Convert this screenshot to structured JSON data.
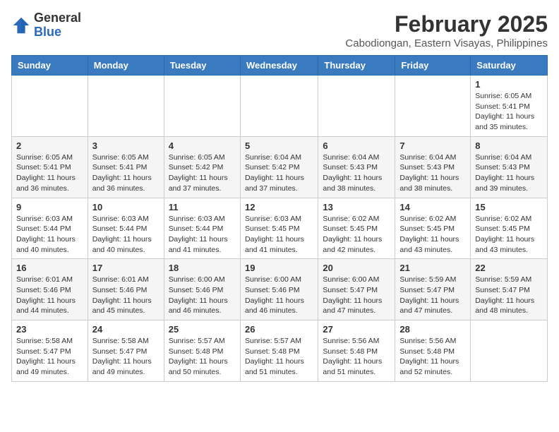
{
  "header": {
    "logo_general": "General",
    "logo_blue": "Blue",
    "month_year": "February 2025",
    "location": "Cabodiongan, Eastern Visayas, Philippines"
  },
  "days_of_week": [
    "Sunday",
    "Monday",
    "Tuesday",
    "Wednesday",
    "Thursday",
    "Friday",
    "Saturday"
  ],
  "weeks": [
    [
      {
        "day": "",
        "info": ""
      },
      {
        "day": "",
        "info": ""
      },
      {
        "day": "",
        "info": ""
      },
      {
        "day": "",
        "info": ""
      },
      {
        "day": "",
        "info": ""
      },
      {
        "day": "",
        "info": ""
      },
      {
        "day": "1",
        "info": "Sunrise: 6:05 AM\nSunset: 5:41 PM\nDaylight: 11 hours and 35 minutes."
      }
    ],
    [
      {
        "day": "2",
        "info": "Sunrise: 6:05 AM\nSunset: 5:41 PM\nDaylight: 11 hours and 36 minutes."
      },
      {
        "day": "3",
        "info": "Sunrise: 6:05 AM\nSunset: 5:41 PM\nDaylight: 11 hours and 36 minutes."
      },
      {
        "day": "4",
        "info": "Sunrise: 6:05 AM\nSunset: 5:42 PM\nDaylight: 11 hours and 37 minutes."
      },
      {
        "day": "5",
        "info": "Sunrise: 6:04 AM\nSunset: 5:42 PM\nDaylight: 11 hours and 37 minutes."
      },
      {
        "day": "6",
        "info": "Sunrise: 6:04 AM\nSunset: 5:43 PM\nDaylight: 11 hours and 38 minutes."
      },
      {
        "day": "7",
        "info": "Sunrise: 6:04 AM\nSunset: 5:43 PM\nDaylight: 11 hours and 38 minutes."
      },
      {
        "day": "8",
        "info": "Sunrise: 6:04 AM\nSunset: 5:43 PM\nDaylight: 11 hours and 39 minutes."
      }
    ],
    [
      {
        "day": "9",
        "info": "Sunrise: 6:03 AM\nSunset: 5:44 PM\nDaylight: 11 hours and 40 minutes."
      },
      {
        "day": "10",
        "info": "Sunrise: 6:03 AM\nSunset: 5:44 PM\nDaylight: 11 hours and 40 minutes."
      },
      {
        "day": "11",
        "info": "Sunrise: 6:03 AM\nSunset: 5:44 PM\nDaylight: 11 hours and 41 minutes."
      },
      {
        "day": "12",
        "info": "Sunrise: 6:03 AM\nSunset: 5:45 PM\nDaylight: 11 hours and 41 minutes."
      },
      {
        "day": "13",
        "info": "Sunrise: 6:02 AM\nSunset: 5:45 PM\nDaylight: 11 hours and 42 minutes."
      },
      {
        "day": "14",
        "info": "Sunrise: 6:02 AM\nSunset: 5:45 PM\nDaylight: 11 hours and 43 minutes."
      },
      {
        "day": "15",
        "info": "Sunrise: 6:02 AM\nSunset: 5:45 PM\nDaylight: 11 hours and 43 minutes."
      }
    ],
    [
      {
        "day": "16",
        "info": "Sunrise: 6:01 AM\nSunset: 5:46 PM\nDaylight: 11 hours and 44 minutes."
      },
      {
        "day": "17",
        "info": "Sunrise: 6:01 AM\nSunset: 5:46 PM\nDaylight: 11 hours and 45 minutes."
      },
      {
        "day": "18",
        "info": "Sunrise: 6:00 AM\nSunset: 5:46 PM\nDaylight: 11 hours and 46 minutes."
      },
      {
        "day": "19",
        "info": "Sunrise: 6:00 AM\nSunset: 5:46 PM\nDaylight: 11 hours and 46 minutes."
      },
      {
        "day": "20",
        "info": "Sunrise: 6:00 AM\nSunset: 5:47 PM\nDaylight: 11 hours and 47 minutes."
      },
      {
        "day": "21",
        "info": "Sunrise: 5:59 AM\nSunset: 5:47 PM\nDaylight: 11 hours and 47 minutes."
      },
      {
        "day": "22",
        "info": "Sunrise: 5:59 AM\nSunset: 5:47 PM\nDaylight: 11 hours and 48 minutes."
      }
    ],
    [
      {
        "day": "23",
        "info": "Sunrise: 5:58 AM\nSunset: 5:47 PM\nDaylight: 11 hours and 49 minutes."
      },
      {
        "day": "24",
        "info": "Sunrise: 5:58 AM\nSunset: 5:47 PM\nDaylight: 11 hours and 49 minutes."
      },
      {
        "day": "25",
        "info": "Sunrise: 5:57 AM\nSunset: 5:48 PM\nDaylight: 11 hours and 50 minutes."
      },
      {
        "day": "26",
        "info": "Sunrise: 5:57 AM\nSunset: 5:48 PM\nDaylight: 11 hours and 51 minutes."
      },
      {
        "day": "27",
        "info": "Sunrise: 5:56 AM\nSunset: 5:48 PM\nDaylight: 11 hours and 51 minutes."
      },
      {
        "day": "28",
        "info": "Sunrise: 5:56 AM\nSunset: 5:48 PM\nDaylight: 11 hours and 52 minutes."
      },
      {
        "day": "",
        "info": ""
      }
    ]
  ]
}
